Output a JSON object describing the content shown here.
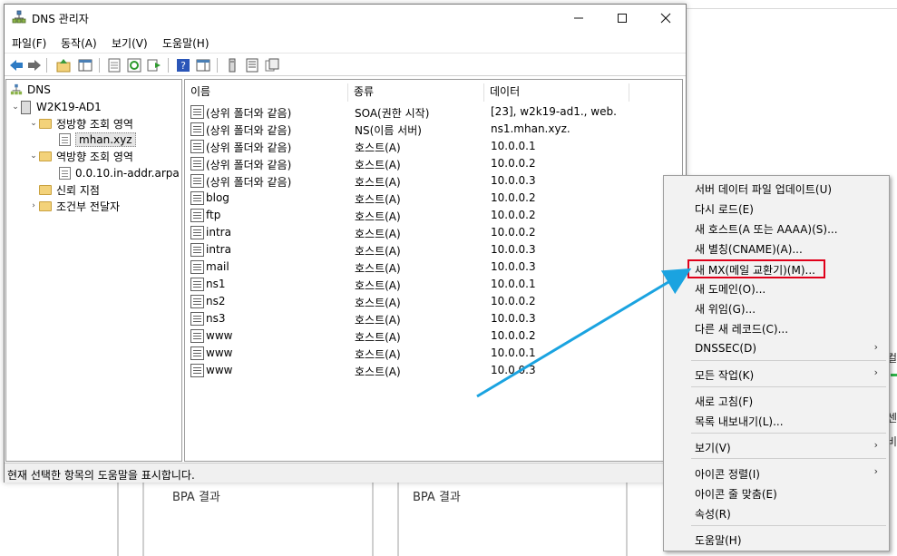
{
  "window": {
    "title": "DNS 관리자",
    "menu": [
      "파일(F)",
      "동작(A)",
      "보기(V)",
      "도움말(H)"
    ]
  },
  "tree": {
    "root": "DNS",
    "server": "W2K19-AD1",
    "forward": "정방향 조회 영역",
    "forward_zone": "mhan.xyz",
    "reverse": "역방향 조회 영역",
    "reverse_zone": "0.0.10.in-addr.arpa",
    "trust": "신뢰 지점",
    "conditional": "조건부 전달자"
  },
  "list": {
    "columns": [
      "이름",
      "종류",
      "데이터"
    ],
    "rows": [
      {
        "name": "(상위 폴더와 같음)",
        "type": "SOA(권한 시작)",
        "data": "[23], w2k19-ad1., web."
      },
      {
        "name": "(상위 폴더와 같음)",
        "type": "NS(이름 서버)",
        "data": "ns1.mhan.xyz."
      },
      {
        "name": "(상위 폴더와 같음)",
        "type": "호스트(A)",
        "data": "10.0.0.1"
      },
      {
        "name": "(상위 폴더와 같음)",
        "type": "호스트(A)",
        "data": "10.0.0.2"
      },
      {
        "name": "(상위 폴더와 같음)",
        "type": "호스트(A)",
        "data": "10.0.0.3"
      },
      {
        "name": "blog",
        "type": "호스트(A)",
        "data": "10.0.0.2"
      },
      {
        "name": "ftp",
        "type": "호스트(A)",
        "data": "10.0.0.2"
      },
      {
        "name": "intra",
        "type": "호스트(A)",
        "data": "10.0.0.2"
      },
      {
        "name": "intra",
        "type": "호스트(A)",
        "data": "10.0.0.3"
      },
      {
        "name": "mail",
        "type": "호스트(A)",
        "data": "10.0.0.3"
      },
      {
        "name": "ns1",
        "type": "호스트(A)",
        "data": "10.0.0.1"
      },
      {
        "name": "ns2",
        "type": "호스트(A)",
        "data": "10.0.0.2"
      },
      {
        "name": "ns3",
        "type": "호스트(A)",
        "data": "10.0.0.3"
      },
      {
        "name": "www",
        "type": "호스트(A)",
        "data": "10.0.0.2"
      },
      {
        "name": "www",
        "type": "호스트(A)",
        "data": "10.0.0.1"
      },
      {
        "name": "www",
        "type": "호스트(A)",
        "data": "10.0.0.3"
      }
    ]
  },
  "status": "현재 선택한 항목의 도움말을 표시합니다.",
  "context_menu": {
    "items": [
      "서버 데이터 파일 업데이트(U)",
      "다시 로드(E)",
      "새 호스트(A 또는 AAAA)(S)...",
      "새 별칭(CNAME)(A)...",
      "새 MX(메일 교환기)(M)...",
      "새 도메인(O)...",
      "새 위임(G)...",
      "다른 새 레코드(C)...",
      "DNSSEC(D)",
      "모든 작업(K)",
      "새로 고침(F)",
      "목록 내보내기(L)...",
      "보기(V)",
      "아이콘 정렬(I)",
      "아이콘 줄 맞춤(E)",
      "속성(R)",
      "도움말(H)"
    ],
    "highlighted": "새 MX(메일 교환기)(M)..."
  },
  "background": {
    "bpa_left": "BPA 결과",
    "bpa_right": "BPA 결과",
    "right_fragments": [
      "컬",
      "I",
      "센",
      "비",
      "I"
    ]
  },
  "colors": {
    "highlight_border": "#e0001a",
    "annotation_arrow": "#1aa3e0"
  }
}
